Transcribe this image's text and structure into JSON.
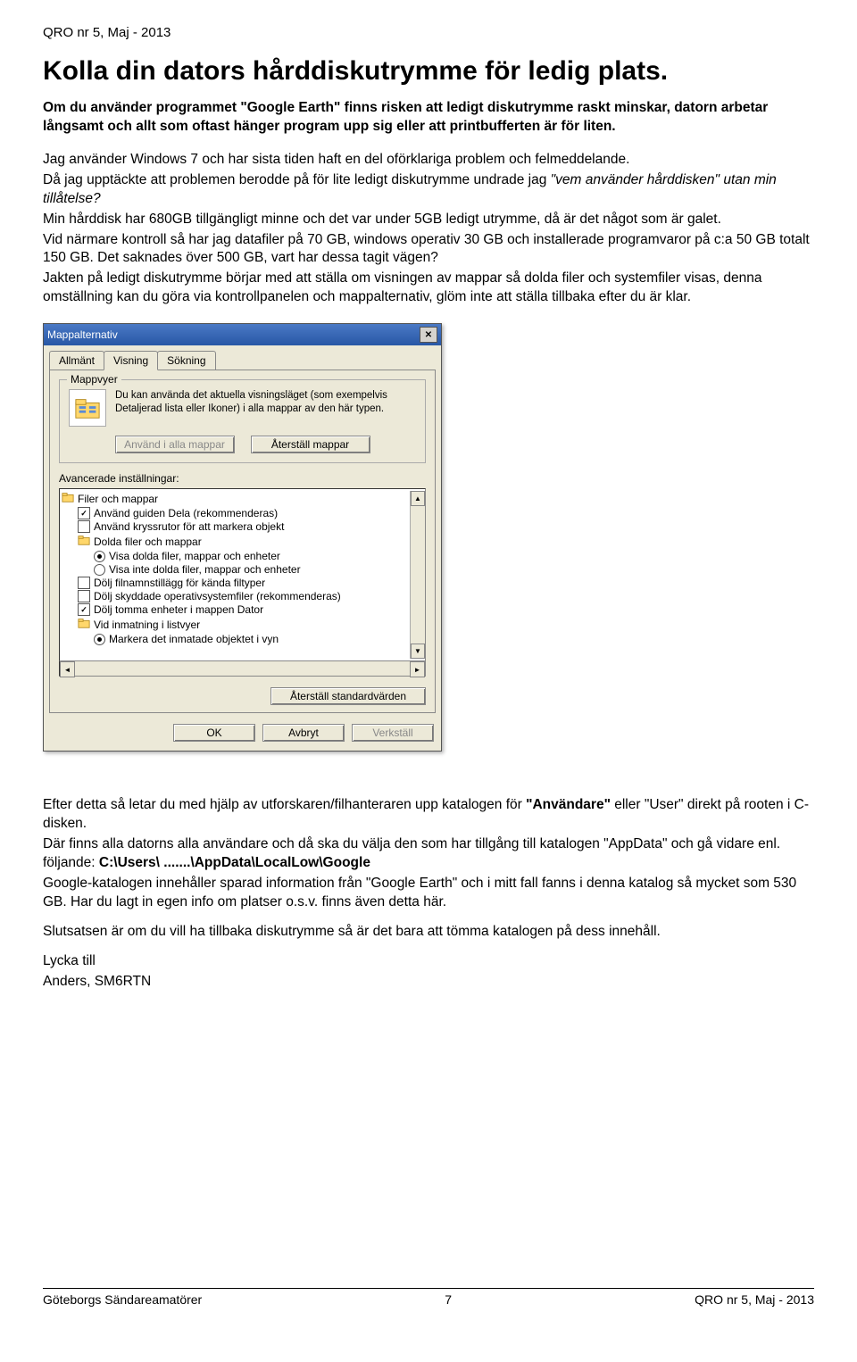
{
  "header": "QRO nr 5, Maj - 2013",
  "title": "Kolla din dators hårddiskutrymme för ledig plats.",
  "lead": "Om du använder programmet \"Google Earth\" finns risken att ledigt diskutrymme raskt minskar, datorn arbetar långsamt och allt som oftast hänger program upp sig eller att printbufferten är för liten.",
  "para1": "Jag använder Windows 7 och har sista tiden haft en del oförklariga problem och felmeddelande.",
  "para2a": "Då jag upptäckte att problemen berodde på för lite ledigt diskutrymme undrade jag ",
  "para2b": "\"vem använder hårddisken\" utan min tillåtelse?",
  "para3": "Min hårddisk har 680GB tillgängligt minne och det var under 5GB ledigt utrymme, då är det något som är galet.",
  "para4": "Vid närmare kontroll så har jag datafiler på 70 GB, windows operativ 30 GB och installerade programvaror på c:a 50 GB totalt 150 GB. Det saknades över 500 GB, vart har dessa tagit vägen?",
  "para5": "Jakten på ledigt diskutrymme börjar med att ställa om visningen av mappar så dolda filer och systemfiler visas, denna omställning kan du göra via kontrollpanelen och mappalternativ, glöm inte att ställa tillbaka efter du är klar.",
  "dialog": {
    "title": "Mappalternativ",
    "tabs": [
      "Allmänt",
      "Visning",
      "Sökning"
    ],
    "group_label": "Mappvyer",
    "folder_text": "Du kan använda det aktuella visningsläget (som exempelvis Detaljerad lista eller Ikoner) i alla mappar av den här typen.",
    "apply_all": "Använd i alla mappar",
    "reset_folders": "Återställ mappar",
    "advanced_label": "Avancerade inställningar:",
    "tree": [
      {
        "type": "folder",
        "indent": 0,
        "text": "Filer och mappar"
      },
      {
        "type": "check",
        "indent": 1,
        "checked": true,
        "text": "Använd guiden Dela (rekommenderas)"
      },
      {
        "type": "check",
        "indent": 1,
        "checked": false,
        "text": "Använd kryssrutor för att markera objekt"
      },
      {
        "type": "folder",
        "indent": 1,
        "text": "Dolda filer och mappar"
      },
      {
        "type": "radio",
        "indent": 2,
        "sel": true,
        "text": "Visa dolda filer, mappar och enheter"
      },
      {
        "type": "radio",
        "indent": 2,
        "sel": false,
        "text": "Visa inte dolda filer, mappar och enheter"
      },
      {
        "type": "check",
        "indent": 1,
        "checked": false,
        "text": "Dölj filnamnstillägg för kända filtyper"
      },
      {
        "type": "check",
        "indent": 1,
        "checked": false,
        "text": "Dölj skyddade operativsystemfiler (rekommenderas)"
      },
      {
        "type": "check",
        "indent": 1,
        "checked": true,
        "text": "Dölj tomma enheter i mappen Dator"
      },
      {
        "type": "folder",
        "indent": 1,
        "text": "Vid inmatning i listvyer"
      },
      {
        "type": "radio",
        "indent": 2,
        "sel": true,
        "text": "Markera det inmatade objektet i vyn"
      }
    ],
    "restore_defaults": "Återställ standardvärden",
    "ok": "OK",
    "cancel": "Avbryt",
    "apply": "Verkställ"
  },
  "lower1a": "Efter detta så letar du med hjälp av utforskaren/filhanteraren upp katalogen för ",
  "lower1_strong": "\"Användare\"",
  "lower1b": "  eller \"User\" direkt på rooten i C-disken.",
  "lower2": "Där finns alla datorns alla användare och då ska du välja den som har tillgång till katalogen \"AppData\" och gå vidare enl.  följande:  ",
  "lower2_path": "C:\\Users\\ .......\\AppData\\LocalLow\\Google",
  "lower3": "Google-katalogen innehåller sparad information från \"Google Earth\" och i mitt fall fanns i denna katalog så mycket som 530 GB. Har du lagt in egen info om platser o.s.v. finns även detta här.",
  "lower4": "Slutsatsen är om du vill ha tillbaka diskutrymme så är det bara att tömma katalogen på dess innehåll.",
  "sign1": "Lycka till",
  "sign2": "Anders, SM6RTN",
  "footer_left": "Göteborgs Sändareamatörer",
  "footer_center": "7",
  "footer_right": "QRO nr 5, Maj - 2013"
}
